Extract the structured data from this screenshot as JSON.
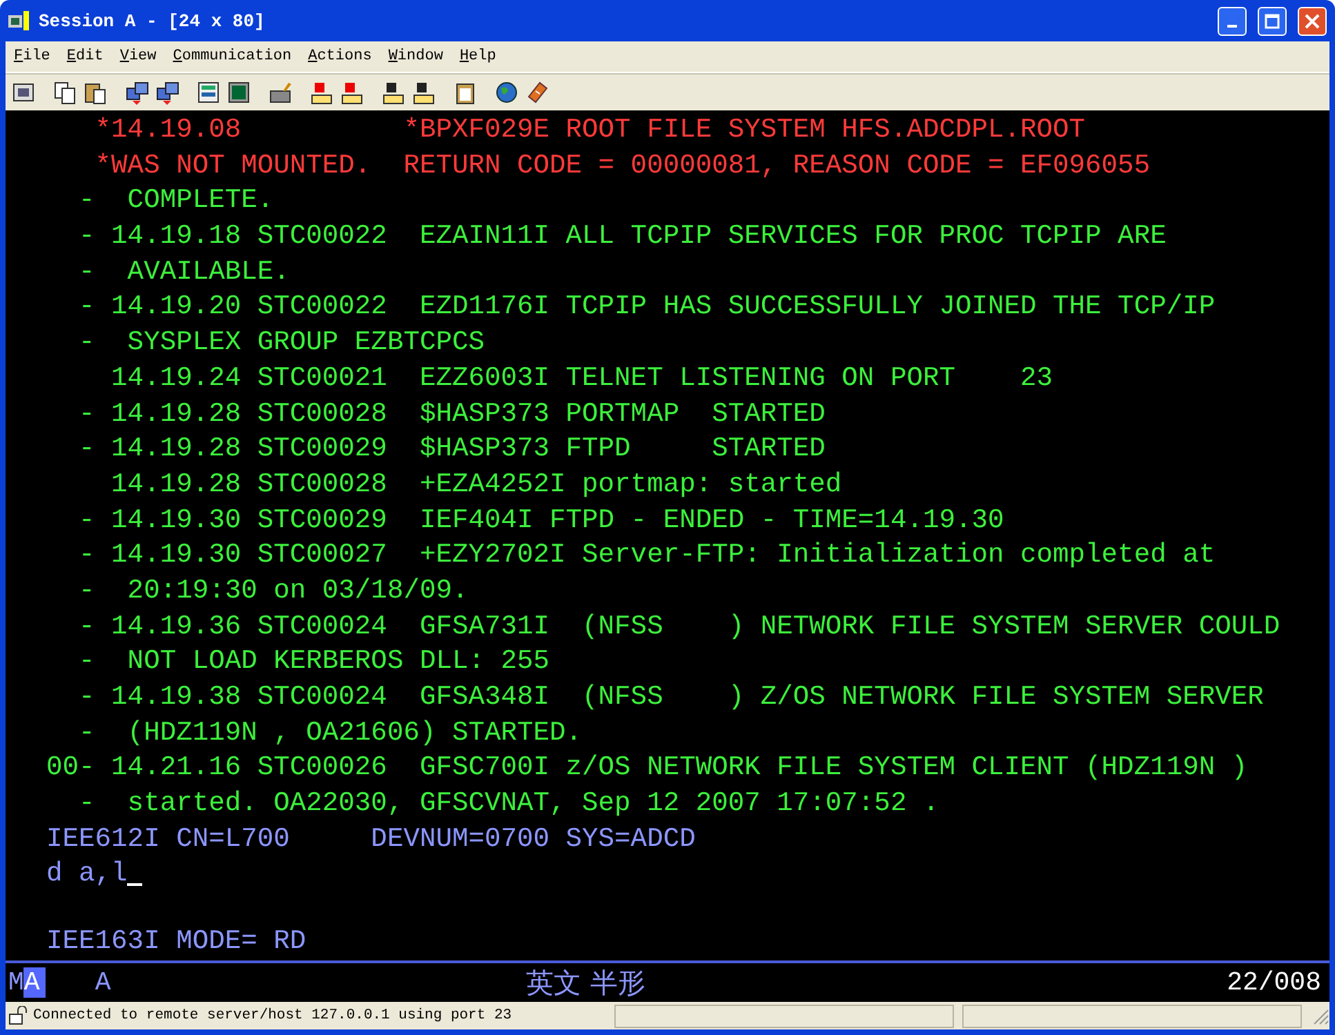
{
  "window": {
    "title": "Session A - [24 x 80]"
  },
  "menu": [
    "File",
    "Edit",
    "View",
    "Communication",
    "Actions",
    "Window",
    "Help"
  ],
  "terminal": {
    "lines": [
      {
        "text": "     *14.19.08          *BPXF029E ROOT FILE SYSTEM HFS.ADCDPL.ROOT",
        "color": "#ff3a3a"
      },
      {
        "text": "     *WAS NOT MOUNTED.  RETURN CODE = 00000081, REASON CODE = EF096055",
        "color": "#ff3a3a"
      },
      {
        "text": "    -  COMPLETE.",
        "color": "#3cf03c"
      },
      {
        "text": "    - 14.19.18 STC00022  EZAIN11I ALL TCPIP SERVICES FOR PROC TCPIP ARE",
        "color": "#3cf03c"
      },
      {
        "text": "    -  AVAILABLE.",
        "color": "#3cf03c"
      },
      {
        "text": "    - 14.19.20 STC00022  EZD1176I TCPIP HAS SUCCESSFULLY JOINED THE TCP/IP",
        "color": "#3cf03c"
      },
      {
        "text": "    -  SYSPLEX GROUP EZBTCPCS",
        "color": "#3cf03c"
      },
      {
        "text": "      14.19.24 STC00021  EZZ6003I TELNET LISTENING ON PORT    23",
        "color": "#3cf03c"
      },
      {
        "text": "    - 14.19.28 STC00028  $HASP373 PORTMAP  STARTED",
        "color": "#3cf03c"
      },
      {
        "text": "    - 14.19.28 STC00029  $HASP373 FTPD     STARTED",
        "color": "#3cf03c"
      },
      {
        "text": "      14.19.28 STC00028  +EZA4252I portmap: started",
        "color": "#3cf03c"
      },
      {
        "text": "    - 14.19.30 STC00029  IEF404I FTPD - ENDED - TIME=14.19.30",
        "color": "#3cf03c"
      },
      {
        "text": "    - 14.19.30 STC00027  +EZY2702I Server-FTP: Initialization completed at",
        "color": "#3cf03c"
      },
      {
        "text": "    -  20:19:30 on 03/18/09.",
        "color": "#3cf03c"
      },
      {
        "text": "    - 14.19.36 STC00024  GFSA731I  (NFSS    ) NETWORK FILE SYSTEM SERVER COULD",
        "color": "#3cf03c"
      },
      {
        "text": "    -  NOT LOAD KERBEROS DLL: 255",
        "color": "#3cf03c"
      },
      {
        "text": "    - 14.19.38 STC00024  GFSA348I  (NFSS    ) Z/OS NETWORK FILE SYSTEM SERVER",
        "color": "#3cf03c"
      },
      {
        "text": "    -  (HDZ119N , OA21606) STARTED.",
        "color": "#3cf03c"
      },
      {
        "text": "  00- 14.21.16 STC00026  GFSC700I z/OS NETWORK FILE SYSTEM CLIENT (HDZ119N )",
        "color": "#3cf03c"
      },
      {
        "text": "    -  started. OA22030, GFSCVNAT, Sep 12 2007 17:07:52 .",
        "color": "#3cf03c"
      },
      {
        "text": "  IEE612I CN=L700     DEVNUM=0700 SYS=ADCD",
        "color": "#8c96ff"
      },
      {
        "text": "  d a,l",
        "color": "#8c96ff",
        "cursor": true
      },
      {
        "text": "  IEE163I MODE= RD",
        "color": "#8c96ff"
      }
    ]
  },
  "oia": {
    "mode_m": "M",
    "mode_a": "A",
    "shift": "A",
    "input_mode": "英文 半形",
    "cursor_position": "22/008"
  },
  "status_bar": {
    "message": "Connected to remote server/host 127.0.0.1 using port 23"
  }
}
